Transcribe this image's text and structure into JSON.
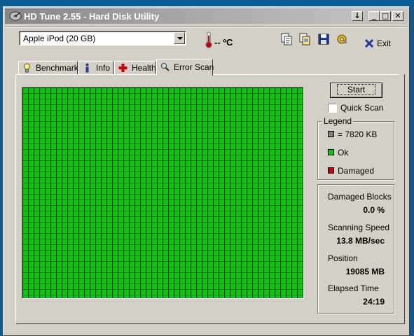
{
  "window": {
    "title": "HD Tune 2.55 - Hard Disk Utility",
    "controls": {
      "menu": "↓",
      "minimize": "_",
      "maximize": "□",
      "close": "✕"
    }
  },
  "toolbar": {
    "drive_selected": "Apple   iPod (20 GB)",
    "temperature": "-- ºC",
    "exit_label": "Exit",
    "icons": [
      "copy-text-icon",
      "copy-screen-icon",
      "save-icon",
      "options-icon",
      "exit-icon"
    ]
  },
  "tabs": [
    {
      "label": "Benchmark",
      "icon": "lightbulb-icon"
    },
    {
      "label": "Info",
      "icon": "info-icon"
    },
    {
      "label": "Health",
      "icon": "health-cross-icon"
    },
    {
      "label": "Error Scan",
      "icon": "magnifier-icon",
      "active": true
    }
  ],
  "scan": {
    "start_label": "Start",
    "quick_scan_label": "Quick Scan",
    "quick_scan_checked": false,
    "block_color": "#00cc00"
  },
  "legend": {
    "title": "Legend",
    "block_size": "= 7820 KB",
    "ok": "Ok",
    "damaged": "Damaged",
    "colors": {
      "block": "#808080",
      "ok": "#00cc00",
      "damaged": "#cc0000"
    }
  },
  "stats": {
    "damaged_blocks_label": "Damaged Blocks",
    "damaged_blocks_value": "0.0 %",
    "scanning_speed_label": "Scanning Speed",
    "scanning_speed_value": "13.8 MB/sec",
    "position_label": "Position",
    "position_value": "19085 MB",
    "elapsed_label": "Elapsed Time",
    "elapsed_value": "24:19"
  }
}
